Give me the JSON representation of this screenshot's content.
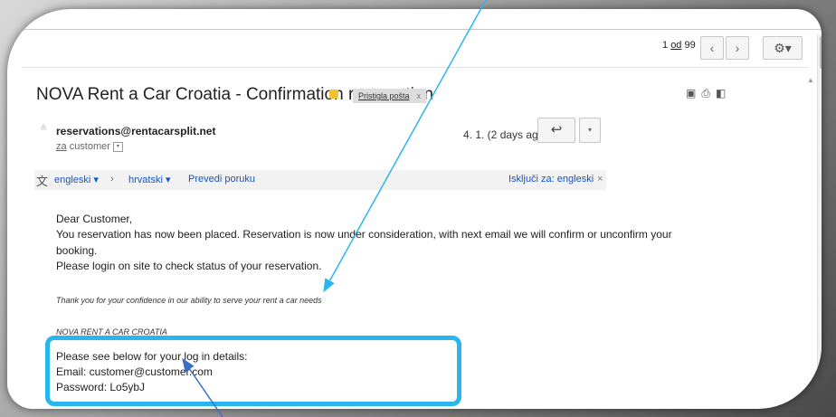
{
  "pager": {
    "current": "1",
    "of_label": "od",
    "total": "99"
  },
  "nav": {
    "prev": "‹",
    "next": "›",
    "settings": "⚙▾"
  },
  "email": {
    "subject": "NOVA Rent a Car Croatia - Confirmation reservation",
    "label": "Pristigla pošta",
    "label_close": "x",
    "sender": "reservations@rentacarsplit.net",
    "to_prefix": "za",
    "to": "customer",
    "date": "4. 1. (2 days ago)",
    "reply": "↩",
    "more": "▾"
  },
  "translate": {
    "from_lang": "engleski ▾",
    "sep": "›",
    "to_lang": "hrvatski ▾",
    "translate_msg": "Prevedi poruku",
    "turn_off": "Isključi za: engleski",
    "close": "×"
  },
  "body": {
    "greeting": "Dear Customer,",
    "line1": "You reservation has now been placed. Reservation is now under consideration, with next email we will confirm or unconfirm your",
    "line2": "booking.",
    "line3": "Please login on site to check status of your reservation.",
    "thanks": "Thank you for your confidence in our ability to serve your rent a car needs",
    "signature": "NOVA RENT A CAR CROATIA",
    "login_intro": "Please see below for your log in details:",
    "email_line": "Email: customer@customer.com",
    "password_line": "Password: Lo5ybJ"
  },
  "colors": {
    "highlight": "#29b6ef",
    "link": "#1155cc",
    "label_dot": "#f1c232"
  }
}
